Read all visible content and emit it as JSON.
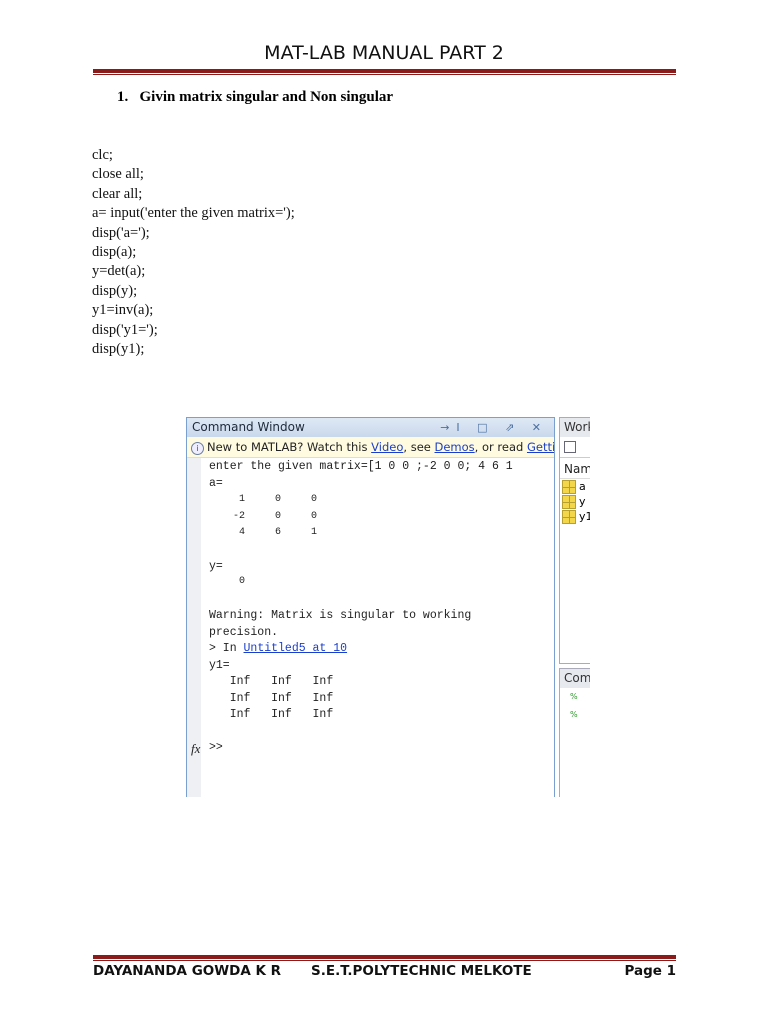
{
  "header": {
    "title": "MAT-LAB MANUAL PART 2"
  },
  "section": {
    "number": "1.",
    "title": "Givin matrix singular and Non singular"
  },
  "code_lines": [
    "clc;",
    "close all;",
    "clear all;",
    "a= input('enter the given matrix=');",
    "disp('a=');",
    "disp(a);",
    "y=det(a);",
    "disp(y);",
    "y1=inv(a);",
    "disp('y1=');",
    "disp(y1);"
  ],
  "command_window": {
    "title": "Command Window",
    "controls": "→I □ ⇗ ✕",
    "info": {
      "prefix": "New to MATLAB? Watch this ",
      "video": "Video",
      "mid1": ", see ",
      "demos": "Demos",
      "mid2": ", or read ",
      "getting_started": "Getting Sta"
    },
    "lines": [
      "enter the given matrix=[1 0 0 ;-2 0 0; 4 6 1",
      "a=",
      "     1     0     0",
      "    -2     0     0",
      "     4     6     1",
      "y=",
      "     0",
      "Warning: Matrix is singular to working",
      "precision.",
      "y1=",
      "   Inf   Inf   Inf",
      "   Inf   Inf   Inf",
      "   Inf   Inf   Inf",
      ">>"
    ],
    "in_prefix": "> In ",
    "in_link": "Untitled5 at 10",
    "fx": "fx"
  },
  "workspace": {
    "title": "Work",
    "column": "Nam",
    "vars": [
      "a",
      "y",
      "y1"
    ]
  },
  "command_history": {
    "title": "Com"
  },
  "footer": {
    "author": "DAYANANDA GOWDA K R",
    "institute": "S.E.T.POLYTECHNIC MELKOTE",
    "page": "Page 1"
  }
}
